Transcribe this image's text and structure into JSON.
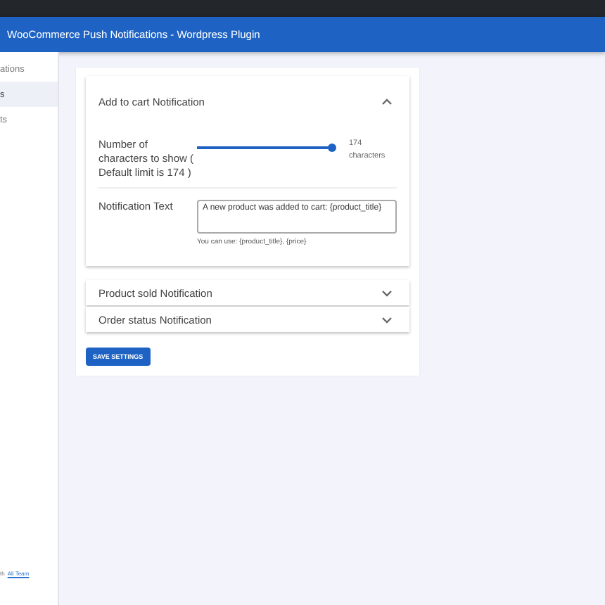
{
  "header": {
    "title": "WooCommerce Push Notifications - Wordpress Plugin"
  },
  "sidebar": {
    "items": [
      {
        "label": "ations",
        "selected": false
      },
      {
        "label": "s",
        "selected": true
      },
      {
        "label": "ts",
        "selected": false
      }
    ],
    "footer": {
      "text": "th",
      "link": "Ali Team"
    }
  },
  "panels": [
    {
      "title": "Add to cart Notification",
      "expanded": true,
      "slider": {
        "label": "Number of characters to show ( Default limit is 174 )",
        "level": 1,
        "reading": "174 characters"
      },
      "text_field": {
        "label": "Notification Text",
        "value": "A new product was added to cart: {product_title}",
        "hint": "You can use: {product_title}, {price}"
      }
    },
    {
      "title": "Product sold Notification",
      "expanded": false
    },
    {
      "title": "Order status Notification",
      "expanded": false
    }
  ],
  "save_button": "SAVE SETTINGS"
}
